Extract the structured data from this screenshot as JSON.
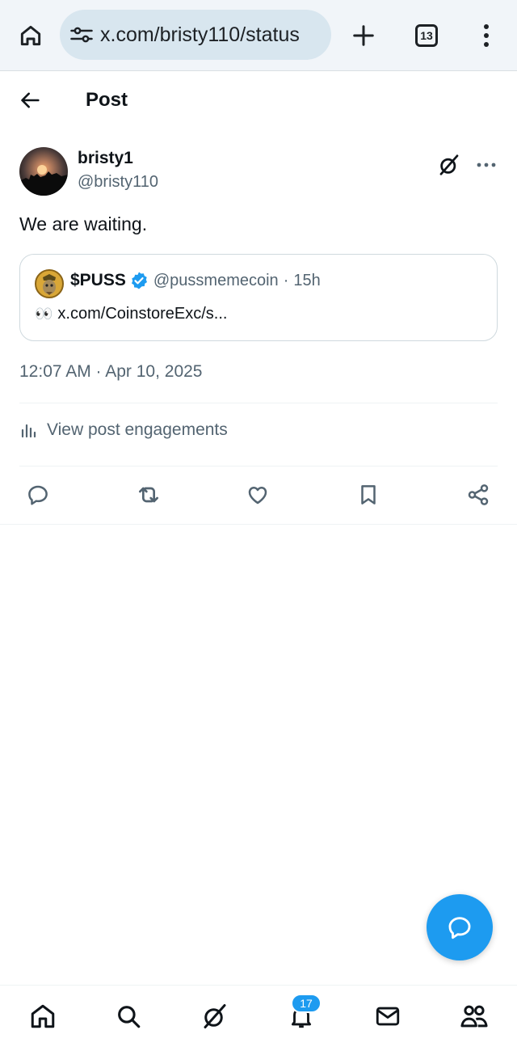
{
  "browser": {
    "url": "x.com/bristy110/status",
    "tab_count": "13",
    "icons": [
      "home-icon",
      "tune-icon",
      "plus-icon",
      "tabs-icon",
      "kebab-menu-icon"
    ]
  },
  "header": {
    "title": "Post",
    "back_icon": "arrow-left-icon"
  },
  "post": {
    "author_name": "bristy1",
    "author_handle": "@bristy110",
    "text": "We are waiting.",
    "timestamp": "12:07 AM · Apr 10, 2025",
    "engagements_label": "View post engagements"
  },
  "quote": {
    "name": "$PUSS",
    "handle": "@pussmemecoin",
    "separator": "·",
    "time": "15h",
    "emoji": "👀",
    "link": "x.com/CoinstoreExc/s..."
  },
  "actions": [
    "reply-icon",
    "repost-icon",
    "like-icon",
    "bookmark-icon",
    "share-icon"
  ],
  "bottom_nav": {
    "items": [
      "home",
      "search",
      "grok",
      "notifications",
      "messages",
      "communities"
    ],
    "notification_count": "17"
  },
  "colors": {
    "accent": "#1d9bf0",
    "text_primary": "#0f1419",
    "text_secondary": "#536471",
    "browser_bar": "#f1f5f9",
    "url_pill": "#d8e6ef"
  }
}
